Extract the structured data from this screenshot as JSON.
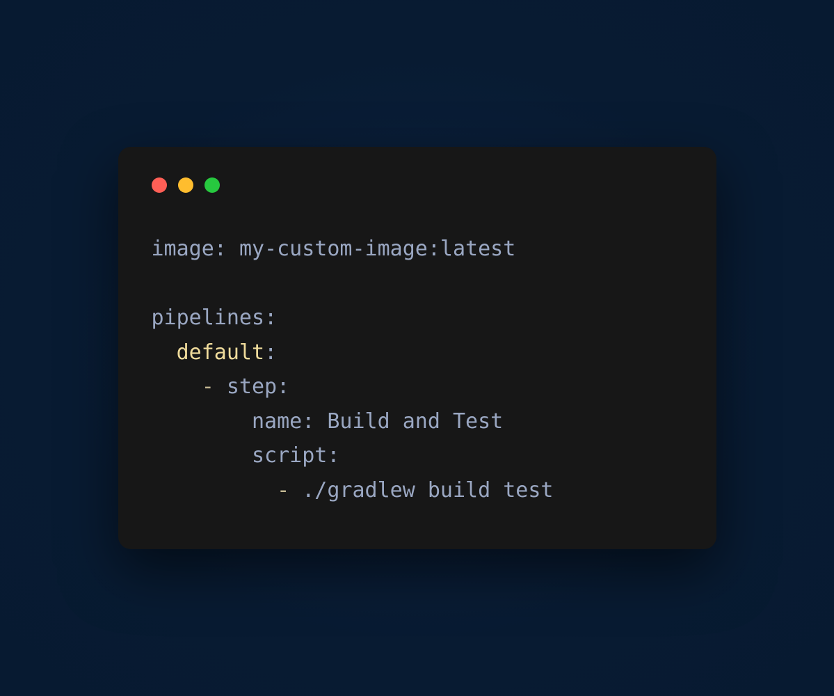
{
  "code": {
    "l1_key": "image",
    "l1_colon": ": ",
    "l1_val": "my-custom-image:latest",
    "blank": "",
    "l3_key": "pipelines",
    "l3_colon": ":",
    "l4_indent": "  ",
    "l4_key": "default",
    "l4_colon": ":",
    "l5_indent": "    ",
    "l5_dash": "- ",
    "l5_key": "step",
    "l5_colon": ":",
    "l6_indent": "        ",
    "l6_key": "name",
    "l6_colon": ": ",
    "l6_val": "Build and Test",
    "l7_indent": "        ",
    "l7_key": "script",
    "l7_colon": ":",
    "l8_indent": "          ",
    "l8_dash": "- ",
    "l8_val": "./gradlew build test"
  }
}
